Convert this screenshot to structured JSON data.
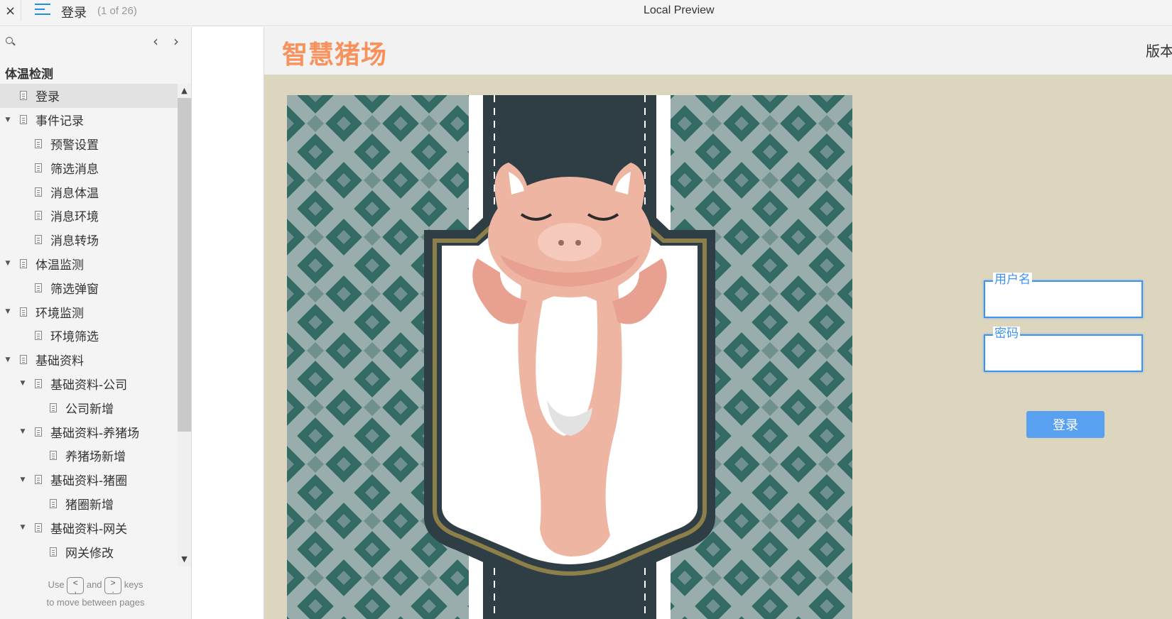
{
  "topbar": {
    "close": "×",
    "page_name": "登录",
    "page_count": "(1 of 26)",
    "window_title": "Local Preview"
  },
  "sidebar": {
    "prev": "‹",
    "next": "›",
    "group_title": "体温检测",
    "items": [
      {
        "label": "登录",
        "level": 0,
        "arrow": false,
        "selected": true
      },
      {
        "label": "事件记录",
        "level": 0,
        "arrow": true
      },
      {
        "label": "预警设置",
        "level": 1,
        "arrow": false
      },
      {
        "label": "筛选消息",
        "level": 1,
        "arrow": false
      },
      {
        "label": "消息体温",
        "level": 1,
        "arrow": false
      },
      {
        "label": "消息环境",
        "level": 1,
        "arrow": false
      },
      {
        "label": "消息转场",
        "level": 1,
        "arrow": false
      },
      {
        "label": "体温监测",
        "level": 0,
        "arrow": true
      },
      {
        "label": "筛选弹窗",
        "level": 1,
        "arrow": false
      },
      {
        "label": "环境监测",
        "level": 0,
        "arrow": true
      },
      {
        "label": "环境筛选",
        "level": 1,
        "arrow": false
      },
      {
        "label": "基础资料",
        "level": 0,
        "arrow": true
      },
      {
        "label": "基础资料-公司",
        "level": 1,
        "arrow": true
      },
      {
        "label": "公司新增",
        "level": 2,
        "arrow": false
      },
      {
        "label": "基础资料-养猪场",
        "level": 1,
        "arrow": true
      },
      {
        "label": "养猪场新增",
        "level": 2,
        "arrow": false
      },
      {
        "label": "基础资料-猪圈",
        "level": 1,
        "arrow": true
      },
      {
        "label": "猪圈新增",
        "level": 2,
        "arrow": false
      },
      {
        "label": "基础资料-网关",
        "level": 1,
        "arrow": true
      },
      {
        "label": "网关修改",
        "level": 2,
        "arrow": false
      }
    ],
    "hint": {
      "use": "Use",
      "key_prev": "<\n,",
      "and": "and",
      "key_next": ">\n.",
      "keys": "keys",
      "line2": "to move between pages"
    }
  },
  "app": {
    "title": "智慧猪场",
    "version": "版本",
    "colors": {
      "title": "#f7925c",
      "background": "#dcd6bf",
      "accent": "#3d93f0"
    },
    "form": {
      "username_label": "用户名",
      "password_label": "密码",
      "login_button": "登录"
    }
  }
}
